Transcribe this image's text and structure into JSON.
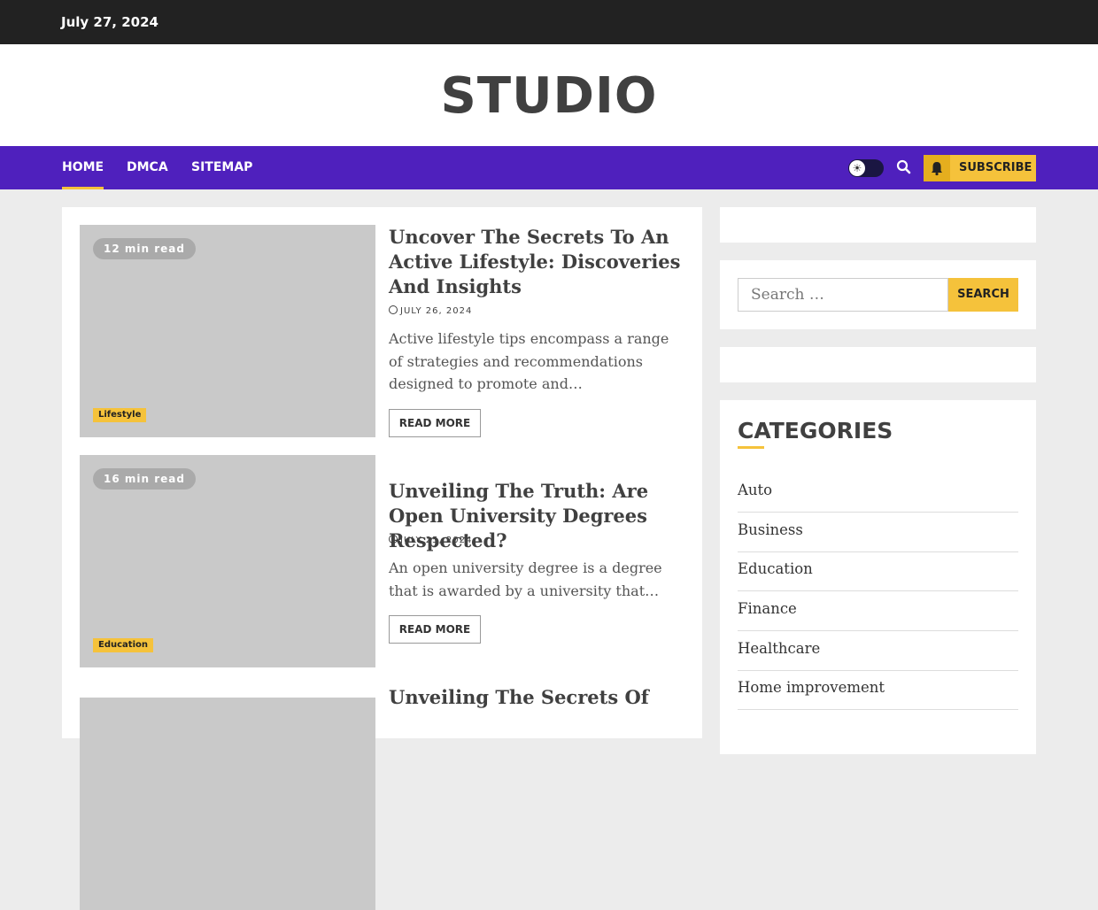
{
  "topbar": {
    "date": "July 27, 2024"
  },
  "site": {
    "title": "STUDIO"
  },
  "nav": {
    "items": [
      {
        "label": "HOME",
        "active": true
      },
      {
        "label": "DMCA",
        "active": false
      },
      {
        "label": "SITEMAP",
        "active": false
      }
    ],
    "subscribe_label": "SUBSCRIBE",
    "icons": {
      "toggle": "sun-toggle-icon",
      "search": "search-icon",
      "bell": "bell-icon"
    }
  },
  "posts": [
    {
      "read_time": "12 min read",
      "category": "Lifestyle",
      "title": "Uncover The Secrets To An Active Lifestyle: Discoveries And Insights",
      "date": "JULY 26, 2024",
      "excerpt": "Active lifestyle tips encompass a range of strategies and recommendations designed to promote and…",
      "read_more": "READ MORE"
    },
    {
      "read_time": "16 min read",
      "category": "Education",
      "title": "Unveiling The Truth: Are Open University Degrees Respected?",
      "date": "JULY 25, 2024",
      "excerpt": "An open university degree is a degree that is awarded by a university that…",
      "read_more": "READ MORE"
    },
    {
      "title": "Unveiling The Secrets Of"
    }
  ],
  "sidebar": {
    "search": {
      "placeholder": "Search …",
      "button": "SEARCH"
    },
    "categories": {
      "heading": "CATEGORIES",
      "items": [
        "Auto",
        "Business",
        "Education",
        "Finance",
        "Healthcare",
        "Home improvement"
      ]
    }
  },
  "colors": {
    "accent": "#f5c23b",
    "nav": "#4f20bd",
    "topbar": "#222222"
  }
}
